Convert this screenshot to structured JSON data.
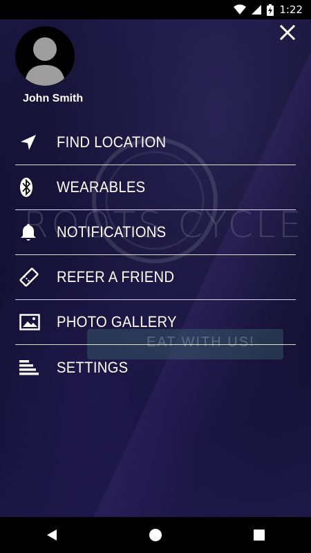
{
  "status_bar": {
    "time": "1:22",
    "icons": [
      "wifi-icon",
      "signal-icon",
      "battery-charging-icon"
    ]
  },
  "background": {
    "logo_text": "ROOTS CYCLE",
    "tagline_fragment": "EAT WITH US!"
  },
  "drawer": {
    "close_icon": "close-icon",
    "user": {
      "name": "John Smith",
      "avatar_icon": "person-avatar-icon"
    },
    "menu": [
      {
        "label": "FIND LOCATION",
        "icon": "navigation-arrow-icon"
      },
      {
        "label": "WEARABLES",
        "icon": "bluetooth-icon"
      },
      {
        "label": "NOTIFICATIONS",
        "icon": "bell-icon"
      },
      {
        "label": "REFER A FRIEND",
        "icon": "ticket-icon"
      },
      {
        "label": "PHOTO GALLERY",
        "icon": "image-icon"
      },
      {
        "label": "SETTINGS",
        "icon": "sort-lines-icon"
      }
    ]
  },
  "nav_bar": {
    "buttons": [
      "back-icon",
      "home-icon",
      "recents-icon"
    ]
  },
  "colors": {
    "background": "#0f0d2a",
    "text": "#ffffff",
    "divider": "#ffffff"
  }
}
